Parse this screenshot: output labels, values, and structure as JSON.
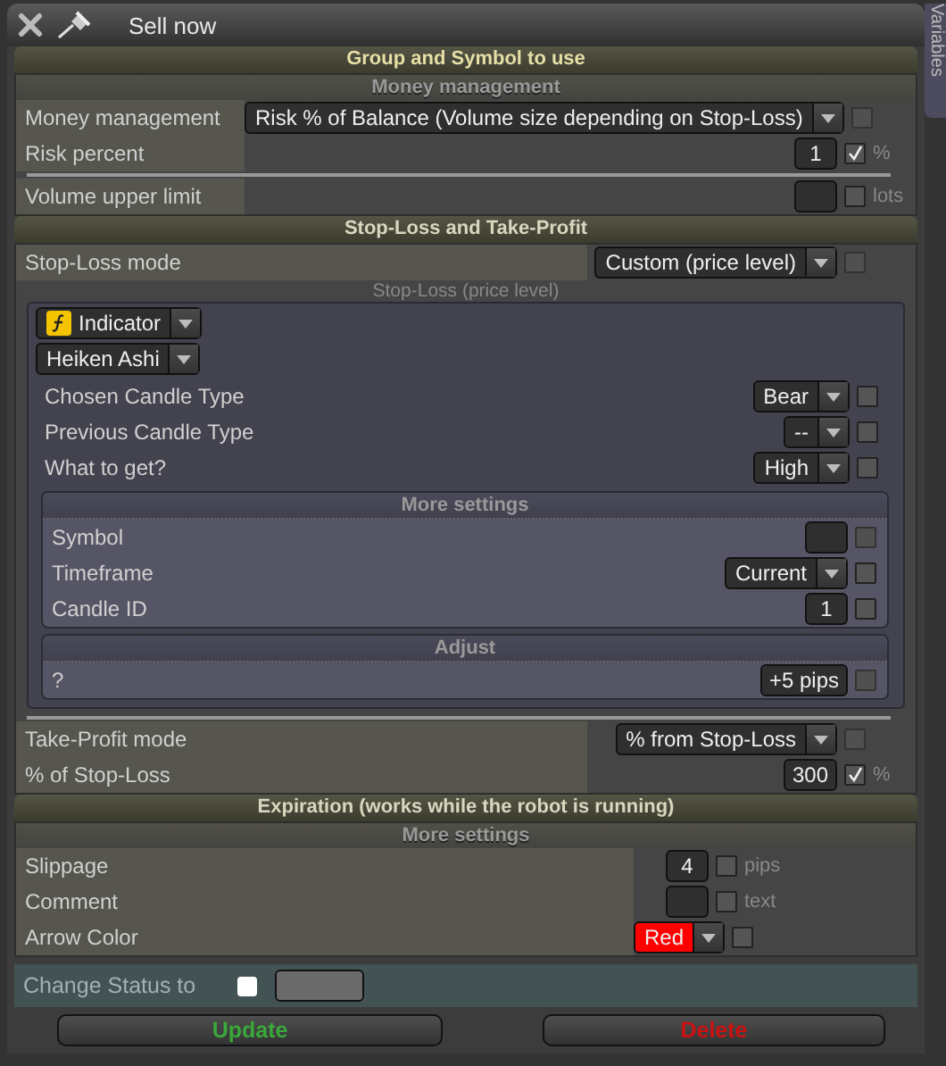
{
  "window": {
    "title": "Sell now"
  },
  "side_tab": {
    "label": "Variables"
  },
  "group_header": "Group and Symbol to use",
  "money": {
    "header": "Money management",
    "rows": [
      {
        "kind": "dropdown",
        "label": "Money management",
        "value": "Risk % of Balance (Volume size depending on Stop-Loss)",
        "checked": false,
        "disabled": true
      },
      {
        "kind": "input",
        "label": "Risk percent",
        "value": "1",
        "checked": true,
        "unit": "%"
      },
      {
        "kind": "input",
        "label": "Volume upper limit",
        "checked": false,
        "unit": "lots",
        "separated": true
      }
    ]
  },
  "stop_loss": {
    "header": "Stop-Loss and Take-Profit",
    "mode": {
      "kind": "dropdown",
      "label": "Stop-Loss mode",
      "value": "Custom (price level)",
      "checked": false,
      "disabled": true
    },
    "caption": "Stop-Loss (price level)",
    "source": {
      "type": "Indicator",
      "name": "Heiken Ashi"
    },
    "rows": [
      {
        "kind": "dropdown",
        "label": "Chosen Candle Type",
        "value": "Bear",
        "checked": false
      },
      {
        "kind": "dropdown",
        "label": "Previous Candle Type",
        "value": "--",
        "checked": false
      },
      {
        "kind": "dropdown",
        "label": "What to get?",
        "value": "High",
        "checked": false
      }
    ],
    "more": {
      "header": "More settings",
      "rows": [
        {
          "kind": "input",
          "label": "Symbol",
          "checked": false,
          "disabled": true
        },
        {
          "kind": "dropdown",
          "label": "Timeframe",
          "value": "Current",
          "checked": false
        },
        {
          "kind": "input",
          "label": "Candle ID",
          "value": "1",
          "checked": false
        }
      ]
    },
    "adjust": {
      "header": "Adjust",
      "rows": [
        {
          "kind": "input",
          "label": "?",
          "value": "+5 pips",
          "checked": false,
          "disabled": true
        }
      ]
    },
    "take_profit": [
      {
        "kind": "dropdown",
        "label": "Take-Profit mode",
        "value": "% from Stop-Loss",
        "checked": false,
        "disabled": true,
        "separated": true
      },
      {
        "kind": "input",
        "label": "% of Stop-Loss",
        "value": "300",
        "checked": true,
        "unit": "%"
      }
    ]
  },
  "expiration": {
    "header": "Expiration (works while the robot is running)",
    "sub_header": "More settings",
    "rows": [
      {
        "kind": "input",
        "label": "Slippage",
        "value": "4",
        "checked": false,
        "unit": "pips"
      },
      {
        "kind": "input",
        "label": "Comment",
        "checked": false,
        "unit": "text"
      },
      {
        "kind": "dropdown",
        "label": "Arrow Color",
        "value": "Red",
        "color": "#ff0000",
        "checked": false
      }
    ]
  },
  "status": {
    "label": "Change Status to",
    "checked": false
  },
  "buttons": [
    {
      "label": "Update",
      "color": "#3aa83a"
    },
    {
      "label": "Delete",
      "color": "#cc1111"
    }
  ]
}
